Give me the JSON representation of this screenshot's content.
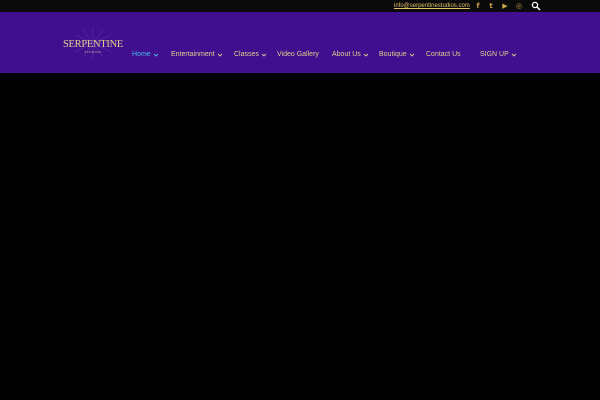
{
  "topbar": {
    "email": "info@serpentinestudios.com",
    "social": [
      {
        "icon": "facebook-icon",
        "glyph": "f"
      },
      {
        "icon": "twitter-icon",
        "glyph": "t"
      },
      {
        "icon": "youtube-icon",
        "glyph": "▶"
      },
      {
        "icon": "instagram-icon",
        "glyph": "◎"
      }
    ]
  },
  "brand": {
    "logo_text": "SERPENTINE",
    "logo_subtext": "STUDIOS"
  },
  "nav": {
    "items": [
      {
        "label": "Home",
        "has_dropdown": true,
        "active": true
      },
      {
        "label": "Entertainment",
        "has_dropdown": true,
        "active": false
      },
      {
        "label": "Classes",
        "has_dropdown": true,
        "active": false
      },
      {
        "label": "Video Gallery",
        "has_dropdown": false,
        "active": false
      },
      {
        "label": "About Us",
        "has_dropdown": true,
        "active": false
      },
      {
        "label": "Boutique",
        "has_dropdown": true,
        "active": false
      },
      {
        "label": "Contact Us",
        "has_dropdown": false,
        "active": false
      },
      {
        "label": "SIGN UP",
        "has_dropdown": true,
        "active": false
      }
    ]
  },
  "colors": {
    "header_bg": "#3f0f8f",
    "page_bg": "#000000",
    "gold_accent": "#e2cf8c",
    "active_link": "#4bb8e6"
  }
}
